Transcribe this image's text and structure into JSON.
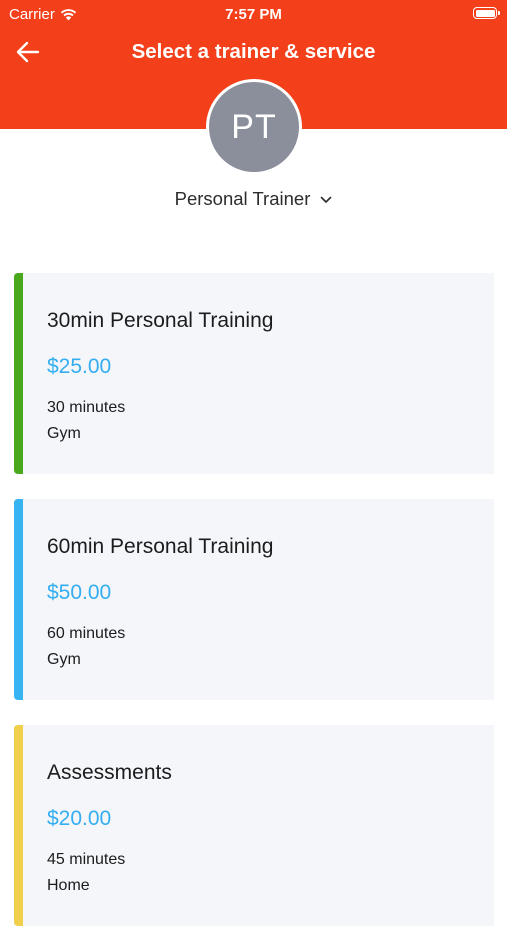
{
  "status_bar": {
    "carrier": "Carrier",
    "time": "7:57 PM"
  },
  "header": {
    "title": "Select a trainer & service",
    "accent_color": "#f33f1a"
  },
  "trainer": {
    "initials": "PT",
    "name": "Personal Trainer"
  },
  "services": [
    {
      "name": "30min Personal Training",
      "price": "$25.00",
      "duration": "30 minutes",
      "location": "Gym",
      "color": "#4aa81c"
    },
    {
      "name": "60min Personal Training",
      "price": "$50.00",
      "duration": "60 minutes",
      "location": "Gym",
      "color": "#36b4f2"
    },
    {
      "name": "Assessments",
      "price": "$20.00",
      "duration": "45 minutes",
      "location": "Home",
      "color": "#f0cf4a"
    }
  ]
}
